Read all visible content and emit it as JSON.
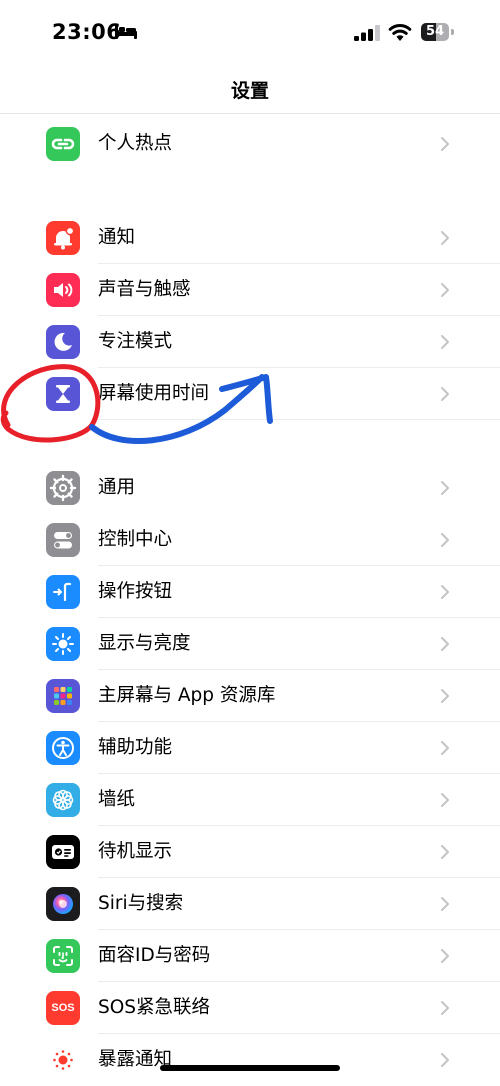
{
  "status_bar": {
    "time": "23:06",
    "battery_level": "54",
    "battery_fraction": 0.54
  },
  "nav": {
    "title": "设置"
  },
  "rows": [
    {
      "label": "个人热点",
      "icon": "hotspot-icon",
      "color": "#34C759"
    },
    {
      "label": "通知",
      "icon": "bell-icon",
      "color": "#FF3B30"
    },
    {
      "label": "声音与触感",
      "icon": "speaker-icon",
      "color": "#FF2D55"
    },
    {
      "label": "专注模式",
      "icon": "moon-icon",
      "color": "#5856D6"
    },
    {
      "label": "屏幕使用时间",
      "icon": "hourglass-icon",
      "color": "#5856D6"
    },
    {
      "label": "通用",
      "icon": "gear-icon",
      "color": "#8E8E93"
    },
    {
      "label": "控制中心",
      "icon": "toggles-icon",
      "color": "#8E8E93"
    },
    {
      "label": "操作按钮",
      "icon": "action-button-icon",
      "color": "#1A8CFF"
    },
    {
      "label": "显示与亮度",
      "icon": "sun-icon",
      "color": "#1A8CFF"
    },
    {
      "label": "主屏幕与 App 资源库",
      "icon": "app-grid-icon",
      "color": "#5856D6"
    },
    {
      "label": "辅助功能",
      "icon": "accessibility-icon",
      "color": "#1A8CFF"
    },
    {
      "label": "墙纸",
      "icon": "flower-icon",
      "color": "#32ADE6"
    },
    {
      "label": "待机显示",
      "icon": "standby-icon",
      "color": "#000000"
    },
    {
      "label": "Siri与搜索",
      "icon": "siri-icon",
      "color": "#1C1C1E"
    },
    {
      "label": "面容ID与密码",
      "icon": "face-id-icon",
      "color": "#34C759"
    },
    {
      "label": "SOS紧急联络",
      "icon": "sos-icon",
      "color": "#FF3B30",
      "badge": "SOS"
    },
    {
      "label": "暴露通知",
      "icon": "exposure-icon",
      "color": "#FFFFFF"
    }
  ],
  "annotations": {
    "circle_color": "#E8202A",
    "arrow_color": "#1E5BD8"
  }
}
